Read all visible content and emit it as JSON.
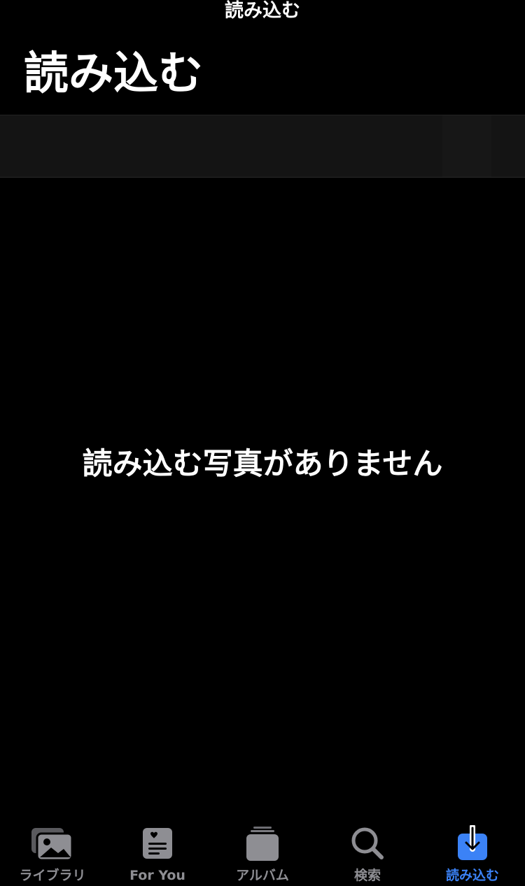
{
  "nav": {
    "small_title": "読み込む",
    "large_title": "読み込む"
  },
  "main": {
    "empty_message": "読み込む写真がありません"
  },
  "tab_bar": {
    "tabs": [
      {
        "label": "ライブラリ",
        "icon": "photo-library-icon",
        "active": false
      },
      {
        "label": "For You",
        "icon": "for-you-icon",
        "active": false
      },
      {
        "label": "アルバム",
        "icon": "albums-icon",
        "active": false
      },
      {
        "label": "検索",
        "icon": "search-icon",
        "active": false
      },
      {
        "label": "読み込む",
        "icon": "import-icon",
        "active": true
      }
    ]
  },
  "colors": {
    "background": "#000000",
    "inactive": "#8e8e93",
    "accent": "#3b82f6"
  }
}
